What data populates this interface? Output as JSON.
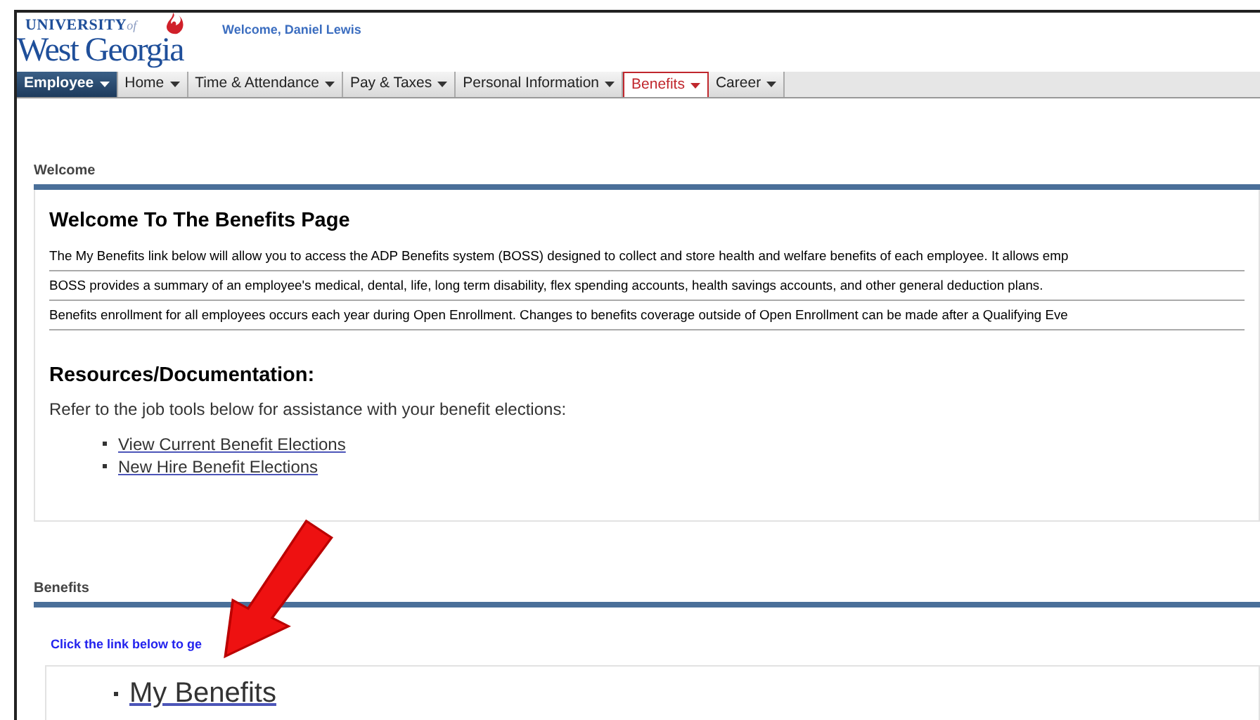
{
  "header": {
    "logo_top": "UNIVERSITY",
    "logo_of": "of",
    "logo_name": "West Georgia",
    "welcome": "Welcome, Daniel Lewis"
  },
  "nav": [
    {
      "kind": "role",
      "label": "Employee",
      "selected": false
    },
    {
      "kind": "tab",
      "label": "Home",
      "selected": false
    },
    {
      "kind": "tab",
      "label": "Time & Attendance",
      "selected": false
    },
    {
      "kind": "tab",
      "label": "Pay & Taxes",
      "selected": false
    },
    {
      "kind": "tab",
      "label": "Personal Information",
      "selected": false
    },
    {
      "kind": "tab",
      "label": "Benefits",
      "selected": true
    },
    {
      "kind": "tab",
      "label": "Career",
      "selected": false
    }
  ],
  "welcome_section": {
    "title": "Welcome",
    "heading": "Welcome To The Benefits Page",
    "paragraphs": [
      "The My Benefits link below will allow you to access the ADP Benefits system (BOSS) designed to collect and store health and welfare benefits of each employee. It allows emp",
      "BOSS provides a summary of an employee's medical, dental, life, long term disability, flex spending accounts, health savings accounts, and other general deduction plans.",
      "Benefits enrollment for all employees occurs each year during Open Enrollment. Changes to benefits coverage outside of Open Enrollment can be made after a Qualifying Eve"
    ],
    "resources_heading": "Resources/Documentation:",
    "resources_intro": "Refer to the job tools below for assistance with your benefit elections:",
    "links": [
      "View Current Benefit Elections",
      "New Hire Benefit Elections"
    ]
  },
  "benefits_section": {
    "title": "Benefits",
    "instruction": "Click the link below to ge",
    "links": [
      "My Benefits"
    ]
  }
}
